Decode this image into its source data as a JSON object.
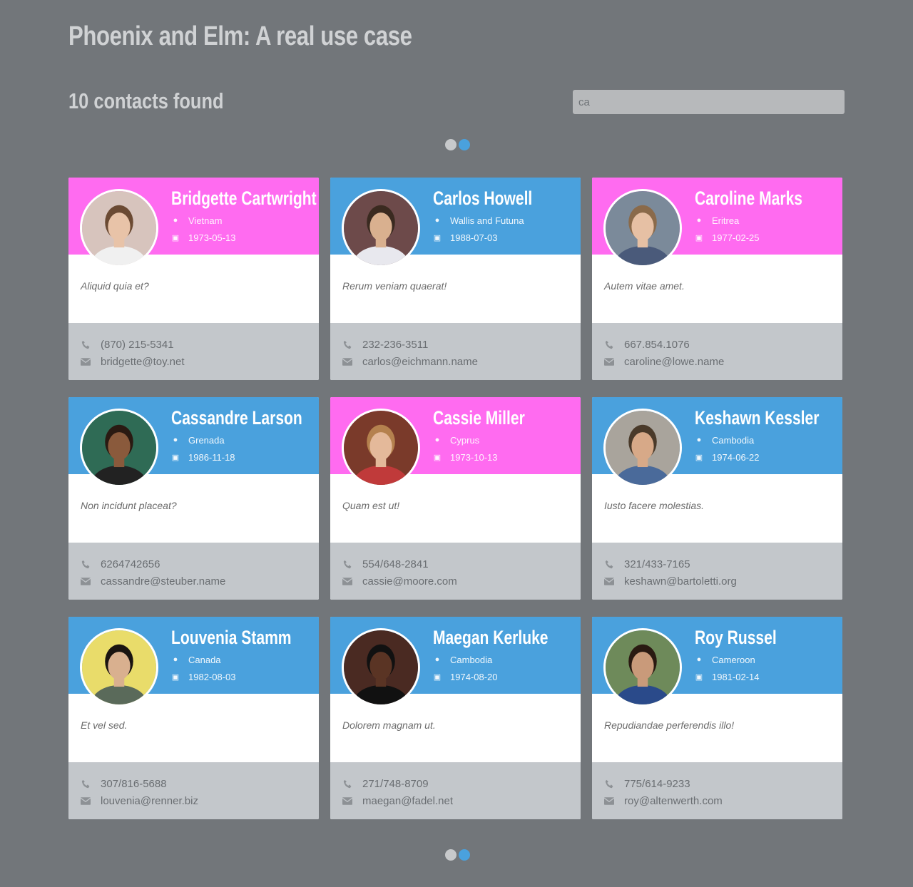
{
  "header": {
    "title": "Phoenix and Elm: A real use case"
  },
  "results": {
    "count_label": "10 contacts found"
  },
  "search": {
    "value": "ca"
  },
  "colors": {
    "pink": "#ff6bf0",
    "blue": "#4aa1dd",
    "background": "#72767a",
    "footer": "#c3c7cb"
  },
  "contacts": [
    {
      "name": "Bridgette Cartwright",
      "location": "Vietnam",
      "birth_date": "1973-05-13",
      "comment": "Aliquid quia et?",
      "phone": "(870) 215-5341",
      "email": "bridgette@toy.net",
      "gender_color": "pink"
    },
    {
      "name": "Carlos Howell",
      "location": "Wallis and Futuna",
      "birth_date": "1988-07-03",
      "comment": "Rerum veniam quaerat!",
      "phone": "232-236-3511",
      "email": "carlos@eichmann.name",
      "gender_color": "blue"
    },
    {
      "name": "Caroline Marks",
      "location": "Eritrea",
      "birth_date": "1977-02-25",
      "comment": "Autem vitae amet.",
      "phone": "667.854.1076",
      "email": "caroline@lowe.name",
      "gender_color": "pink"
    },
    {
      "name": "Cassandre Larson",
      "location": "Grenada",
      "birth_date": "1986-11-18",
      "comment": "Non incidunt placeat?",
      "phone": "6264742656",
      "email": "cassandre@steuber.name",
      "gender_color": "blue"
    },
    {
      "name": "Cassie Miller",
      "location": "Cyprus",
      "birth_date": "1973-10-13",
      "comment": "Quam est ut!",
      "phone": "554/648-2841",
      "email": "cassie@moore.com",
      "gender_color": "pink"
    },
    {
      "name": "Keshawn Kessler",
      "location": "Cambodia",
      "birth_date": "1974-06-22",
      "comment": "Iusto facere molestias.",
      "phone": "321/433-7165",
      "email": "keshawn@bartoletti.org",
      "gender_color": "blue"
    },
    {
      "name": "Louvenia Stamm",
      "location": "Canada",
      "birth_date": "1982-08-03",
      "comment": "Et vel sed.",
      "phone": "307/816-5688",
      "email": "louvenia@renner.biz",
      "gender_color": "blue"
    },
    {
      "name": "Maegan Kerluke",
      "location": "Cambodia",
      "birth_date": "1974-08-20",
      "comment": "Dolorem magnam ut.",
      "phone": "271/748-8709",
      "email": "maegan@fadel.net",
      "gender_color": "blue"
    },
    {
      "name": "Roy Russel",
      "location": "Cameroon",
      "birth_date": "1981-02-14",
      "comment": "Repudiandae perferendis illo!",
      "phone": "775/614-9233",
      "email": "roy@altenwerth.com",
      "gender_color": "blue"
    }
  ],
  "pagination": {
    "pages": 2,
    "current": 2
  }
}
